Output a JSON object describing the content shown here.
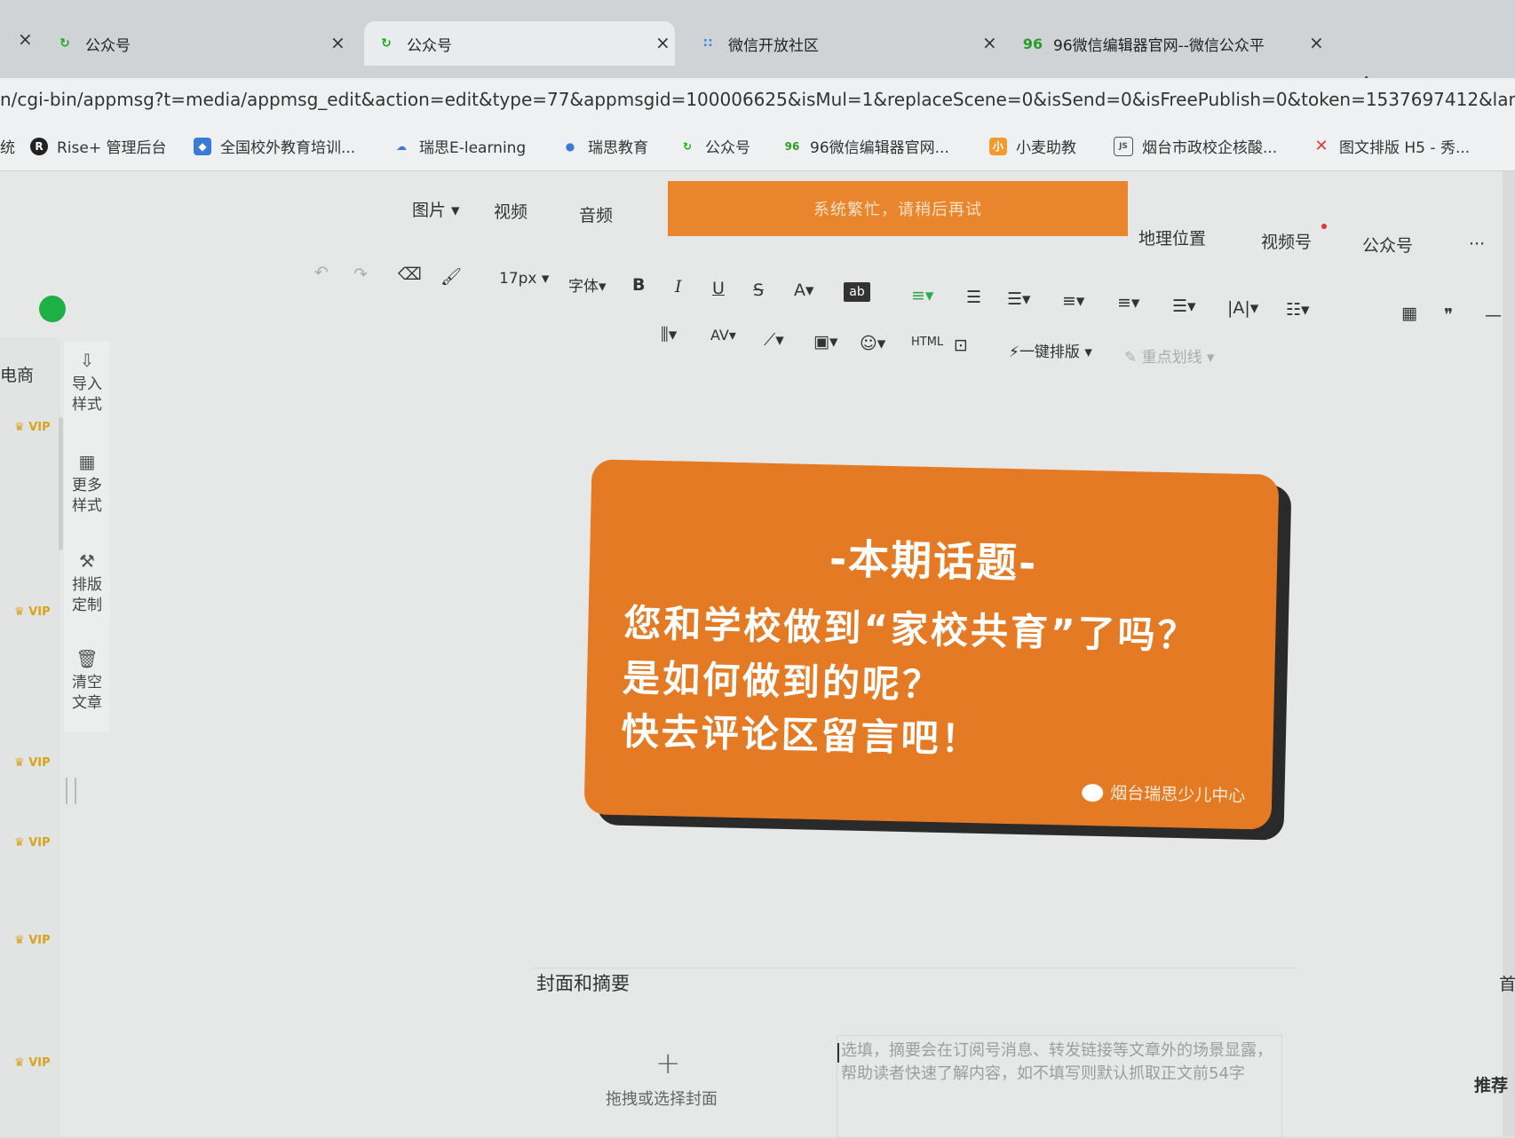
{
  "browser": {
    "tabs": [
      {
        "title": "公众号",
        "icon": "wechat-mp-icon"
      },
      {
        "title": "公众号",
        "icon": "wechat-mp-icon",
        "active": true
      },
      {
        "title": "微信开放社区",
        "icon": "grid-dots-icon"
      },
      {
        "title": "96微信编辑器官网--微信公众平",
        "icon": "96-logo-icon"
      }
    ],
    "close_glyph": "×",
    "new_tab_glyph": "+",
    "url": "n/cgi-bin/appmsg?t=media/appmsg_edit&action=edit&type=77&appmsgid=100006625&isMul=1&replaceScene=0&isSend=0&isFreePublish=0&token=1537697412&lang=zh_",
    "bookmarks": [
      {
        "label": "Rise+ 管理后台",
        "color": "#222222"
      },
      {
        "label": "全国校外教育培训...",
        "color": "#3a7bd5"
      },
      {
        "label": "瑞思E-learning",
        "color": "#3a7bd5"
      },
      {
        "label": "瑞思教育",
        "color": "#3a7bd5"
      },
      {
        "label": "公众号",
        "color": "#1aad19"
      },
      {
        "label": "96微信编辑器官网...",
        "color": "#2a9b2a"
      },
      {
        "label": "小麦助教",
        "color": "#f29a2e"
      },
      {
        "label": "烟台市政校企核酸...",
        "color": "#555555"
      },
      {
        "label": "图文排版 H5 - 秀...",
        "color": "#e0353a"
      }
    ],
    "bookmark_prefix": "统"
  },
  "editor": {
    "media_bar": {
      "image": "图片",
      "video": "视频",
      "audio": "音频",
      "location": "地理位置",
      "channels": "视频号",
      "official_account": "公众号",
      "more": "···"
    },
    "toast": "系统繁忙，请稍后再试",
    "toolbar": {
      "font_size": "17px",
      "font_family": "字体",
      "bold": "B",
      "italic": "I",
      "underline": "U",
      "strike": "S",
      "font_color": "A",
      "highlight": "ab",
      "quote": "❞",
      "one_click_format": "一键排版",
      "key_underline": "重点划线"
    },
    "left_rail": [
      {
        "label_line1": "导入",
        "label_line2": "样式",
        "icon": "import-icon"
      },
      {
        "label_line1": "更多",
        "label_line2": "样式",
        "icon": "grid-icon"
      },
      {
        "label_line1": "排版",
        "label_line2": "定制",
        "icon": "hammer-icon"
      },
      {
        "label_line1": "清空",
        "label_line2": "文章",
        "icon": "trash-icon"
      }
    ],
    "left_cut_text": "电商",
    "vip_badge": "VIP",
    "card": {
      "title": "-本期话题-",
      "lines": [
        "您和学校做到“家校共育”了吗？",
        "是如何做到的呢？",
        "快去评论区留言吧！"
      ],
      "watermark": "烟台瑞思少儿中心",
      "bg_color": "#e57a24"
    },
    "cover": {
      "section_label": "封面和摘要",
      "add_glyph": "+",
      "add_cover_text": "拖拽或选择封面"
    },
    "summary_placeholder": "选填，摘要会在订阅号消息、转发链接等文章外的场景显露，帮助读者快速了解内容，如不填写则默认抓取正文前54字",
    "right_recommend": "推荐",
    "right_cut": "首"
  }
}
